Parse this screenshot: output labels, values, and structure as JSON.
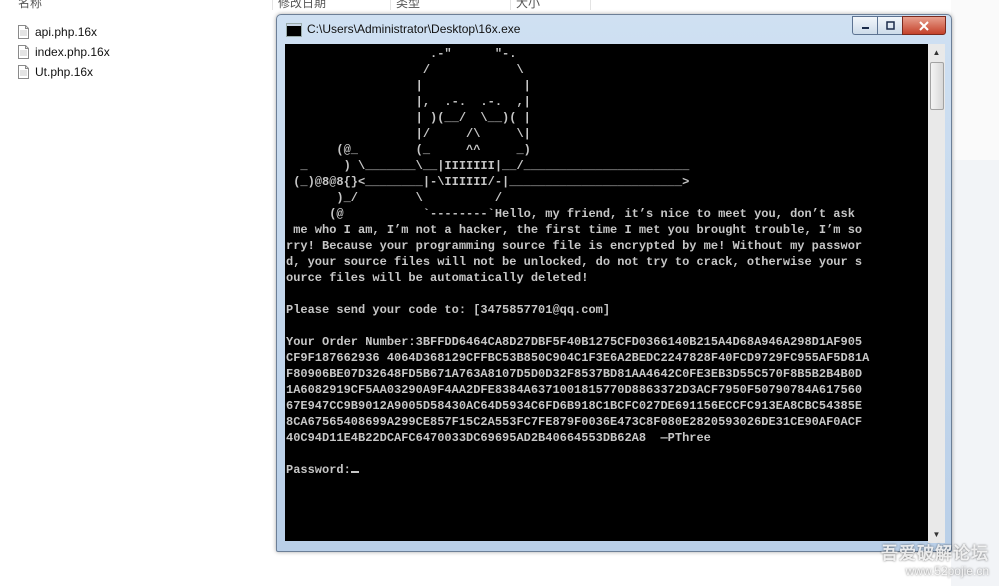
{
  "explorer": {
    "columns": [
      "名称",
      "修改日期",
      "类型",
      "大小"
    ],
    "files": [
      {
        "name": "api.php.16x",
        "icon": "file-icon"
      },
      {
        "name": "index.php.16x",
        "icon": "file-icon"
      },
      {
        "name": "Ut.php.16x",
        "icon": "file-icon"
      }
    ]
  },
  "console": {
    "title": "C:\\Users\\Administrator\\Desktop\\16x.exe",
    "output": "                    .-\"      \"-.\n                   /            \\\n                  |              |\n                  |,  .-.  .-.  ,|\n                  | )(__/  \\__)( |\n                  |/     /\\     \\|\n       (@_        (_     ^^     _)\n  _     ) \\_______\\__|IIIIIII|__/_______________________\n (_)@8@8{}<________|-\\IIIIII/-|________________________>\n       )_/        \\          /\n      (@           `--------`Hello, my friend, it’s nice to meet you, don’t ask\n me who I am, I’m not a hacker, the first time I met you brought trouble, I’m so\nrry! Because your programming source file is encrypted by me! Without my passwor\nd, your source files will not be unlocked, do not try to crack, otherwise your s\nource files will be automatically deleted!\n\nPlease send your code to: [3475857701@qq.com]\n\nYour Order Number:3BFFDD6464CA8D27DBF5F40B1275CFD0366140B215A4D68A946A298D1AF905\nCF9F187662936 4064D368129CFFBC53B850C904C1F3E6A2BEDC2247828F40FCD9729FC955AF5D81A\nF80906BE07D32648FD5B671A763A8107D5D0D32F8537BD81AA4642C0FE3EB3D55C570F8B5B2B4B0D\n1A6082919CF5AA03290A9F4AA2DFE8384A6371001815770D8863372D3ACF7950F50790784A617560\n67E947CC9B9012A9005D58430AC64D5934C6FD6B918C1BCFC027DE691156ECCFC913EA8CBC54385E\n8CA67565408699A299CE857F15C2A553FC7FE879F0036E473C8F080E2820593026DE31CE90AF0ACF\n40C94D11E4B22DCAFC6470033DC69695AD2B40664553DB62A8  —PThree\n\nPassword:"
  },
  "watermark": {
    "name": "吾爱破解论坛",
    "url": "www.52pojie.cn"
  }
}
